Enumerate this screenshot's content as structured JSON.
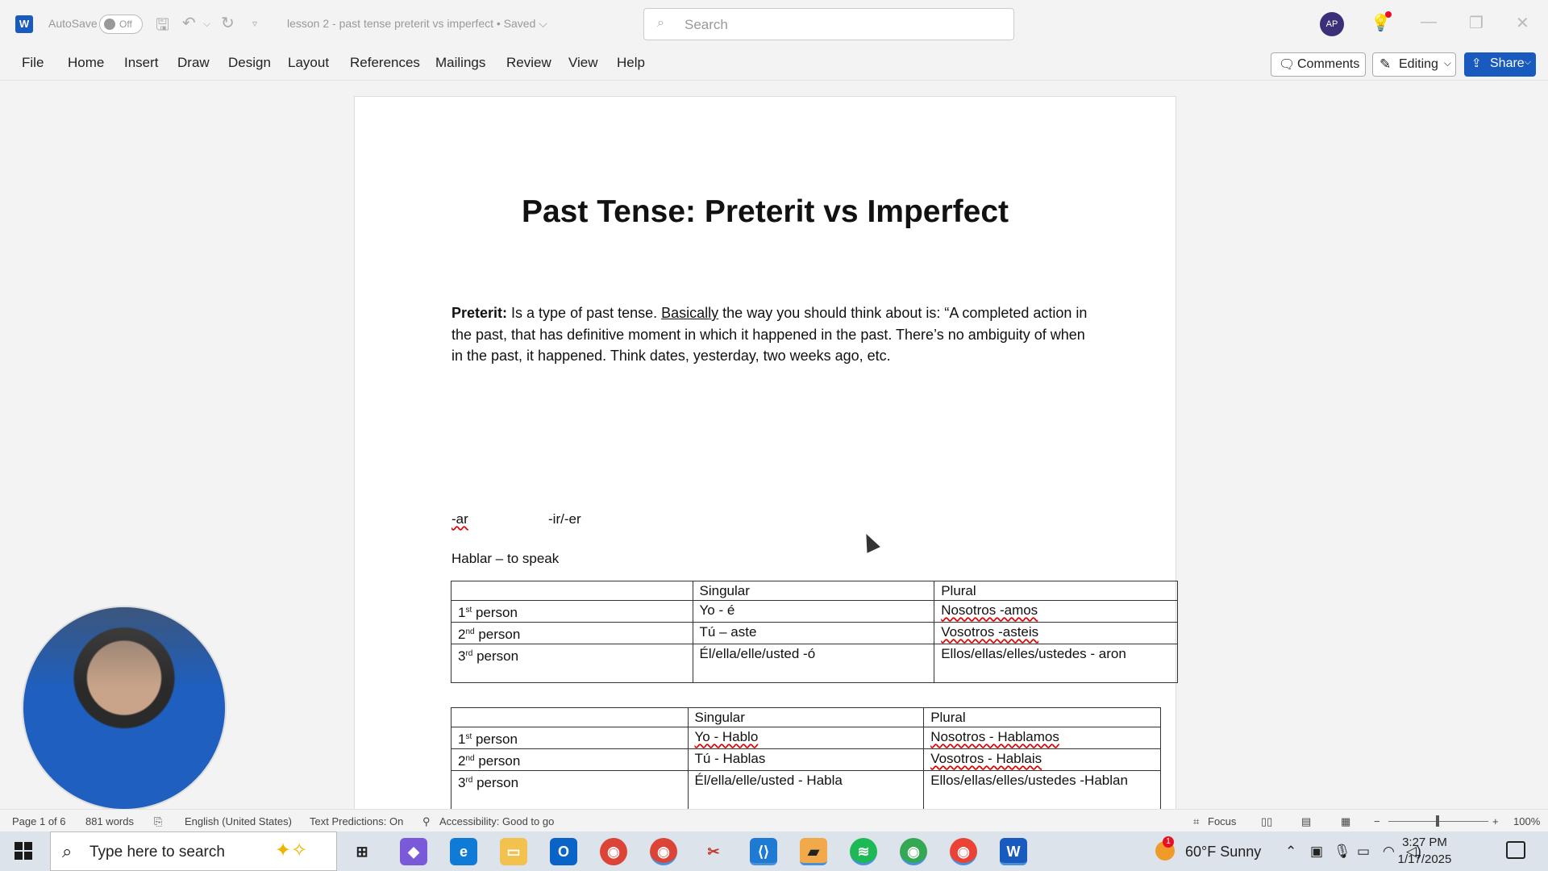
{
  "titlebar": {
    "autosave_label": "AutoSave",
    "autosave_state": "Off",
    "doc_title": "lesson 2 - past tense preterit vs imperfect • Saved ⌵",
    "search_placeholder": "Search",
    "avatar_initials": "AP"
  },
  "menu": {
    "items": [
      "File",
      "Home",
      "Insert",
      "Draw",
      "Design",
      "Layout",
      "References",
      "Mailings",
      "Review",
      "View",
      "Help"
    ],
    "comments": "Comments",
    "editing": "Editing",
    "share": "Share"
  },
  "document": {
    "heading": "Past Tense: Preterit vs Imperfect",
    "para_term": "Preterit:",
    "para_before": " Is a type of past tense. ",
    "para_underlined": "Basically",
    "para_after": " the way you should think about is: “A completed action in the past, that has definitive moment in which it happened in the past. There’s no ambiguity of when in the past, it happened. Think dates, yesterday, two weeks ago, etc.",
    "ending_ar": "-ar",
    "ending_ir_er": "-ir/-er",
    "verb_line": "Hablar – to speak",
    "table1": {
      "header": [
        "",
        "Singular",
        "Plural"
      ],
      "rows": [
        {
          "person_num": "1",
          "person_sup": "st",
          "person_word": " person",
          "singular": "Yo - é",
          "plural": "Nosotros -amos"
        },
        {
          "person_num": "2",
          "person_sup": "nd",
          "person_word": " person",
          "singular": "Tú – aste",
          "plural": "Vosotros -asteis"
        },
        {
          "person_num": "3",
          "person_sup": "rd",
          "person_word": " person",
          "singular": "Él/ella/elle/usted -ó",
          "plural": "Ellos/ellas/elles/ustedes - aron"
        }
      ]
    },
    "table2": {
      "header": [
        "",
        "Singular",
        "Plural"
      ],
      "rows": [
        {
          "person_num": "1",
          "person_sup": "st",
          "person_word": " person",
          "singular": "Yo - Hablo",
          "plural": "Nosotros - Hablamos"
        },
        {
          "person_num": "2",
          "person_sup": "nd",
          "person_word": " person",
          "singular": "Tú - Hablas",
          "plural": "Vosotros - Hablais"
        },
        {
          "person_num": "3",
          "person_sup": "rd",
          "person_word": " person",
          "singular": "Él/ella/elle/usted - Habla",
          "plural": "Ellos/ellas/elles/ustedes -Hablan"
        }
      ]
    }
  },
  "statusbar": {
    "page": "Page 1 of 6",
    "words": "881 words",
    "language": "English (United States)",
    "predictions": "Text Predictions: On",
    "accessibility": "Accessibility: Good to go",
    "focus": "Focus",
    "zoom": "100%"
  },
  "taskbar": {
    "search_placeholder": "Type here to search",
    "weather": "60°F  Sunny",
    "weather_badge": "1",
    "time": "3:27 PM",
    "date": "1/17/2025",
    "colors": {
      "word": "#185abd",
      "edge": "#0f7bd6",
      "spotify": "#1db954",
      "vscode": "#1e7ad3"
    }
  }
}
